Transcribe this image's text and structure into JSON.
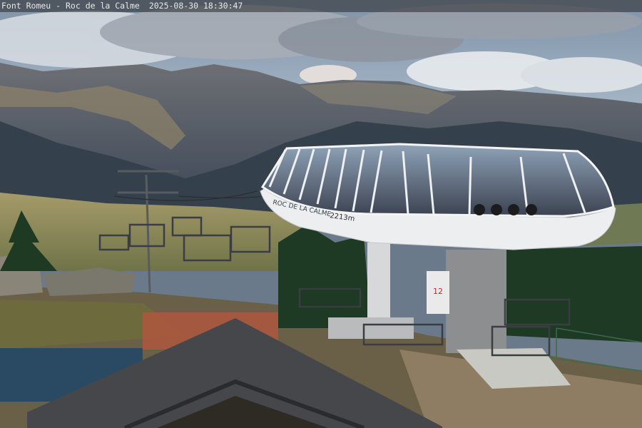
{
  "overlay": {
    "location": "Font Romeu - Roc de la Calme",
    "datetime": "2025-08-30 18:30:47"
  },
  "station": {
    "name_sign": "ROC DE LA CALME",
    "altitude": "2213m"
  },
  "tower_sign": {
    "number": "12"
  },
  "colors": {
    "sky": "#9fb5cc",
    "mountains": "#4d5566",
    "terminal": "#e9ecef",
    "trees": "#1f3a24",
    "ground": "#8a7b5e",
    "roof": "#3e3e42"
  }
}
